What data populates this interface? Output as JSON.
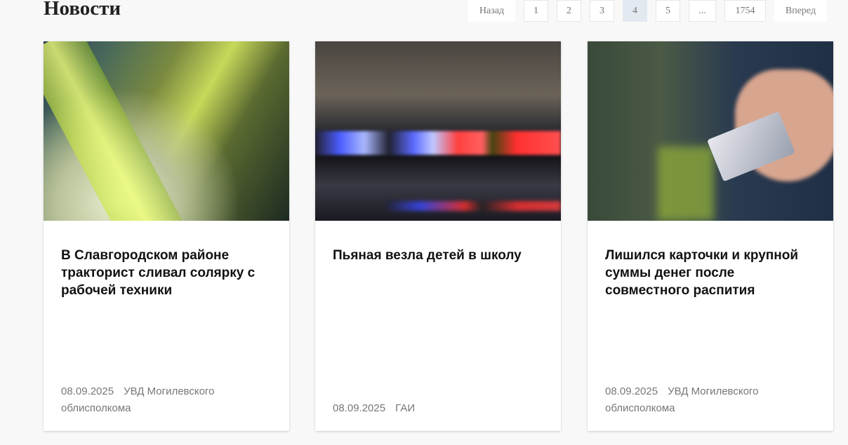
{
  "page": {
    "title": "Новости"
  },
  "pagination": {
    "prev": "Назад",
    "pages": [
      "1",
      "2",
      "3",
      "4",
      "5",
      "...",
      "1754"
    ],
    "active": "4",
    "next": "Вперед"
  },
  "news": [
    {
      "title": "В Славгородском районе тракторист сливал солярку с рабочей техники",
      "date": "08.09.2025",
      "source": "УВД Могилевского облисполкома"
    },
    {
      "title": "Пьяная везла детей в школу",
      "date": "08.09.2025",
      "source": "ГАИ"
    },
    {
      "title": "Лишился карточки и крупной суммы денег после совместного распития",
      "date": "08.09.2025",
      "source": "УВД Могилевского облисполкома"
    }
  ]
}
